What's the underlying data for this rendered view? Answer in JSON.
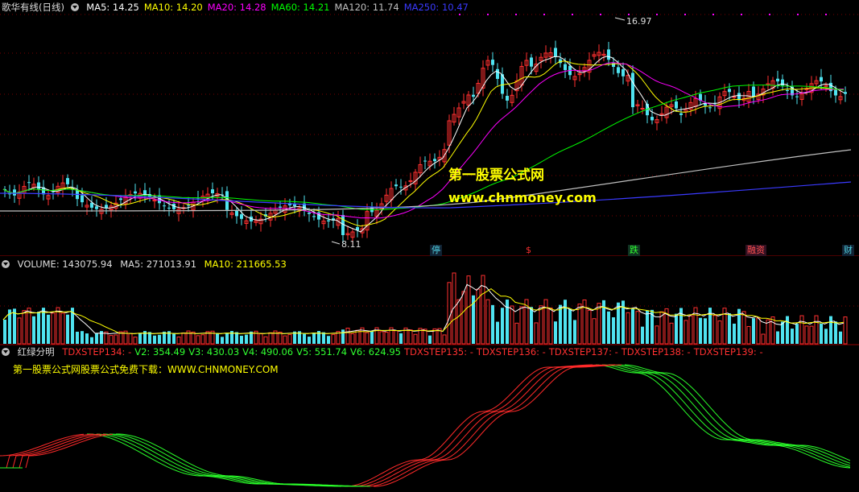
{
  "main": {
    "title": "歌华有线(日线)",
    "ma": [
      {
        "label": "MA5: 14.25",
        "color": "#ffffff"
      },
      {
        "label": "MA10: 14.20",
        "color": "#ffff00"
      },
      {
        "label": "MA20: 14.28",
        "color": "#ff00ff"
      },
      {
        "label": "MA60: 14.21",
        "color": "#00ff00"
      },
      {
        "label": "MA120: 11.74",
        "color": "#c0c0c0"
      },
      {
        "label": "MA250: 10.47",
        "color": "#3a3aff"
      }
    ],
    "high_label": "16.97",
    "low_label": "8.11",
    "event_tags": [
      {
        "text": "停",
        "color": "#4fd0e0"
      },
      {
        "text": "$",
        "color": "#ff3030"
      },
      {
        "text": "跌",
        "color": "#30ff30"
      },
      {
        "text": "融资",
        "color": "#ff5050"
      },
      {
        "text": "财",
        "color": "#4fd0e0"
      }
    ]
  },
  "watermark": {
    "line1": "第一股票公式网",
    "line2": "www.chnmoney.com"
  },
  "volume": {
    "label": "VOLUME: 143075.94",
    "ma5": "MA5: 271013.91",
    "ma10": "MA10: 211665.53"
  },
  "indicator": {
    "name": "红绿分明",
    "values": [
      {
        "label": "TDXSTEP134: -",
        "color": "#ff3030"
      },
      {
        "label": "V2: 354.49",
        "color": "#30ff30"
      },
      {
        "label": "V3: 430.03",
        "color": "#30ff30"
      },
      {
        "label": "V4: 490.06",
        "color": "#30ff30"
      },
      {
        "label": "V5: 551.74",
        "color": "#30ff30"
      },
      {
        "label": "V6: 624.95",
        "color": "#30ff30"
      },
      {
        "label": "TDXSTEP135: -",
        "color": "#ff3030"
      },
      {
        "label": "TDXSTEP136: -",
        "color": "#ff3030"
      },
      {
        "label": "TDXSTEP137: -",
        "color": "#ff3030"
      },
      {
        "label": "TDXSTEP138: -",
        "color": "#ff3030"
      },
      {
        "label": "TDXSTEP139: -",
        "color": "#ff3030"
      }
    ],
    "promo": "第一股票公式网股票公式免费下载：WWW.CHNMONEY.COM"
  },
  "chart_data": {
    "type": "line",
    "title": "歌华有线(日线)",
    "price_range": [
      8.11,
      16.97
    ],
    "series": [
      {
        "name": "MA5",
        "last": 14.25
      },
      {
        "name": "MA10",
        "last": 14.2
      },
      {
        "name": "MA20",
        "last": 14.28
      },
      {
        "name": "MA60",
        "last": 14.21
      },
      {
        "name": "MA120",
        "last": 11.74
      },
      {
        "name": "MA250",
        "last": 10.47
      }
    ],
    "volume": {
      "last": 143075.94,
      "ma5": 271013.91,
      "ma10": 211665.53
    },
    "indicator_values": {
      "V2": 354.49,
      "V3": 430.03,
      "V4": 490.06,
      "V5": 551.74,
      "V6": 624.95
    }
  }
}
